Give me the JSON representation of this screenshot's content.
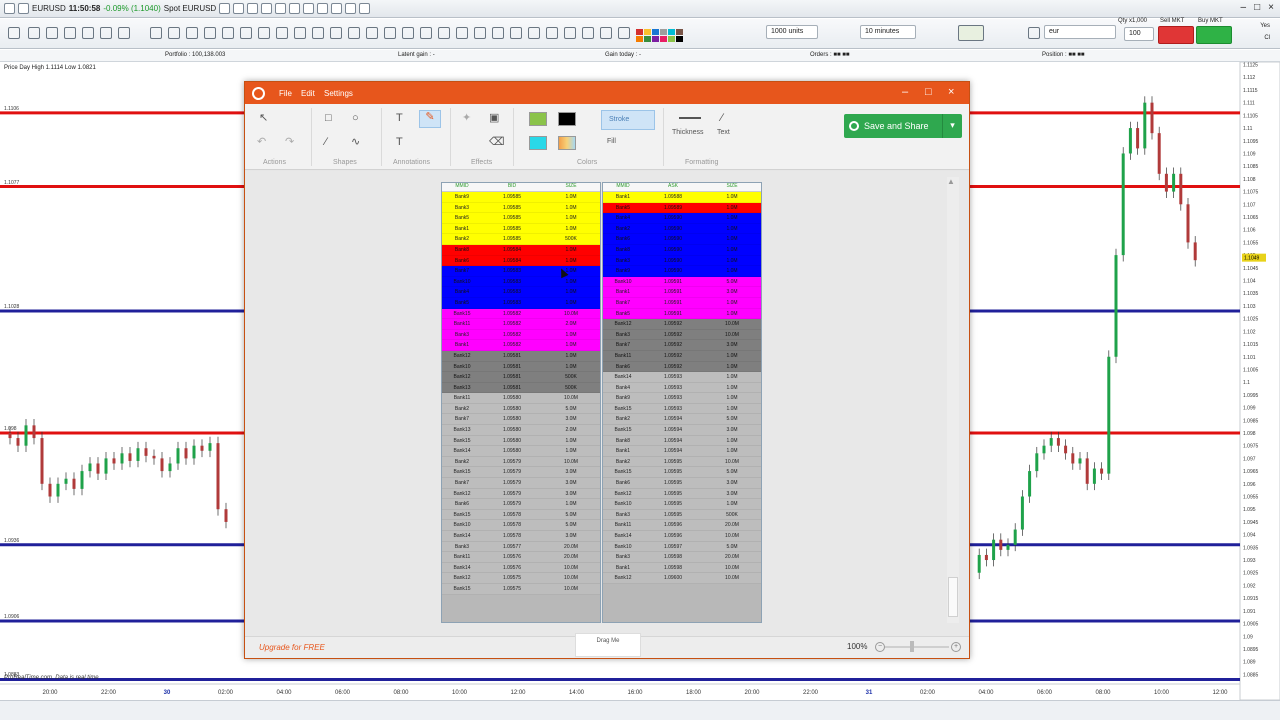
{
  "platform": {
    "top": {
      "instrument": "EURUSD",
      "time": "11:50:58",
      "change": "-0.09% (1.1040)",
      "spot": "Spot EURUSD"
    },
    "units": "1000 units",
    "timeframe": "10 minutes",
    "instrument_field": "eur",
    "order_labels": {
      "qty": "Qty x1,000",
      "sell": "Sell MKT",
      "buy": "Buy MKT"
    },
    "qty_value": "100",
    "side_checks": [
      "Yes",
      "Cl"
    ],
    "infobar": {
      "portfolio": "Portfolio : 100,138.003",
      "latent": "Latent gain : -",
      "gain_today": "Gain today : -",
      "orders": "Orders : ■■ ■■",
      "position": "Position : ■■ ■■"
    },
    "chart_header": "Price  Day High 1.1114 Low 1.0821",
    "watermark": "ProRealTime.com. Data is real time",
    "level_labels": [
      "1.1106",
      "1.1077",
      "1.1028",
      "1.098",
      "1.0936",
      "1.0906",
      "1.0883"
    ]
  },
  "tool": {
    "menu": [
      "File",
      "Edit",
      "Settings"
    ],
    "groups": [
      "Actions",
      "Shapes",
      "Annotations",
      "Effects",
      "Colors",
      "Formatting"
    ],
    "stroke_label": "Stroke",
    "fill_label": "Fill",
    "thickness_label": "Thickness",
    "text_label": "Text",
    "save_label": "Save and Share",
    "upgrade_label": "Upgrade for FREE",
    "drag_label": "Drag Me",
    "zoom_label": "100%",
    "colors": {
      "green": "#8bc34a",
      "black": "#000000",
      "cyan": "#29d8e8",
      "accent": "#e7561c"
    }
  },
  "dom": {
    "bid_header": [
      "MMID",
      "BID",
      "SIZE"
    ],
    "ask_header": [
      "MMID",
      "ASK",
      "SIZE"
    ],
    "bids": [
      [
        "Bank9",
        "1.09585",
        "1.0M"
      ],
      [
        "Bank3",
        "1.09585",
        "1.0M"
      ],
      [
        "Bank5",
        "1.09585",
        "1.0M"
      ],
      [
        "Bank1",
        "1.09585",
        "1.0M"
      ],
      [
        "Bank2",
        "1.09585",
        "500K"
      ],
      [
        "Bank8",
        "1.09584",
        "1.0M"
      ],
      [
        "Bank6",
        "1.09584",
        "1.0M"
      ],
      [
        "Bank7",
        "1.09583",
        "1.0M"
      ],
      [
        "Bank10",
        "1.09583",
        "1.0M"
      ],
      [
        "Bank4",
        "1.09583",
        "1.0M"
      ],
      [
        "Bank5",
        "1.09583",
        "1.0M"
      ],
      [
        "Bank15",
        "1.09582",
        "10.0M"
      ],
      [
        "Bank11",
        "1.09582",
        "2.0M"
      ],
      [
        "Bank3",
        "1.09582",
        "1.0M"
      ],
      [
        "Bank1",
        "1.09582",
        "1.0M"
      ],
      [
        "Bank12",
        "1.09581",
        "1.0M"
      ],
      [
        "Bank10",
        "1.09581",
        "1.0M"
      ],
      [
        "Bank12",
        "1.09581",
        "500K"
      ],
      [
        "Bank13",
        "1.09581",
        "500K"
      ],
      [
        "Bank11",
        "1.09580",
        "10.0M"
      ],
      [
        "Bank2",
        "1.09580",
        "5.0M"
      ],
      [
        "Bank7",
        "1.09580",
        "3.0M"
      ],
      [
        "Bank13",
        "1.09580",
        "2.0M"
      ],
      [
        "Bank15",
        "1.09580",
        "1.0M"
      ],
      [
        "Bank14",
        "1.09580",
        "1.0M"
      ],
      [
        "Bank2",
        "1.09579",
        "10.0M"
      ],
      [
        "Bank15",
        "1.09579",
        "3.0M"
      ],
      [
        "Bank7",
        "1.09579",
        "3.0M"
      ],
      [
        "Bank12",
        "1.09579",
        "3.0M"
      ],
      [
        "Bank6",
        "1.09579",
        "1.0M"
      ],
      [
        "Bank15",
        "1.09578",
        "5.0M"
      ],
      [
        "Bank10",
        "1.09578",
        "5.0M"
      ],
      [
        "Bank14",
        "1.09578",
        "3.0M"
      ],
      [
        "Bank3",
        "1.09577",
        "20.0M"
      ],
      [
        "Bank11",
        "1.09576",
        "20.0M"
      ],
      [
        "Bank14",
        "1.09576",
        "10.0M"
      ],
      [
        "Bank12",
        "1.09575",
        "10.0M"
      ],
      [
        "Bank15",
        "1.09575",
        "10.0M"
      ]
    ],
    "asks": [
      [
        "Bank1",
        "1.09588",
        "1.0M"
      ],
      [
        "Bank5",
        "1.09589",
        "1.0M"
      ],
      [
        "Bank4",
        "1.09590",
        "1.0M"
      ],
      [
        "Bank2",
        "1.09590",
        "1.0M"
      ],
      [
        "Bank6",
        "1.09590",
        "1.0M"
      ],
      [
        "Bank8",
        "1.09590",
        "1.0M"
      ],
      [
        "Bank3",
        "1.09590",
        "1.0M"
      ],
      [
        "Bank9",
        "1.09590",
        "1.0M"
      ],
      [
        "Bank10",
        "1.09591",
        "5.0M"
      ],
      [
        "Bank1",
        "1.09591",
        "3.0M"
      ],
      [
        "Bank7",
        "1.09591",
        "1.0M"
      ],
      [
        "Bank5",
        "1.09591",
        "1.0M"
      ],
      [
        "Bank12",
        "1.09592",
        "10.0M"
      ],
      [
        "Bank3",
        "1.09592",
        "10.0M"
      ],
      [
        "Bank7",
        "1.09592",
        "3.0M"
      ],
      [
        "Bank11",
        "1.09592",
        "1.0M"
      ],
      [
        "Bank6",
        "1.09592",
        "1.0M"
      ],
      [
        "Bank14",
        "1.09593",
        "1.0M"
      ],
      [
        "Bank4",
        "1.09593",
        "1.0M"
      ],
      [
        "Bank9",
        "1.09593",
        "1.0M"
      ],
      [
        "Bank15",
        "1.09593",
        "1.0M"
      ],
      [
        "Bank2",
        "1.09594",
        "5.0M"
      ],
      [
        "Bank15",
        "1.09594",
        "3.0M"
      ],
      [
        "Bank8",
        "1.09594",
        "1.0M"
      ],
      [
        "Bank1",
        "1.09594",
        "1.0M"
      ],
      [
        "Bank2",
        "1.09595",
        "10.0M"
      ],
      [
        "Bank15",
        "1.09595",
        "5.0M"
      ],
      [
        "Bank6",
        "1.09595",
        "3.0M"
      ],
      [
        "Bank12",
        "1.09595",
        "3.0M"
      ],
      [
        "Bank10",
        "1.09595",
        "1.0M"
      ],
      [
        "Bank3",
        "1.09595",
        "500K"
      ],
      [
        "Bank11",
        "1.09596",
        "20.0M"
      ],
      [
        "Bank14",
        "1.09596",
        "10.0M"
      ],
      [
        "Bank10",
        "1.09597",
        "5.0M"
      ],
      [
        "Bank3",
        "1.09598",
        "20.0M"
      ],
      [
        "Bank1",
        "1.09598",
        "10.0M"
      ],
      [
        "Bank12",
        "1.09600",
        "10.0M"
      ]
    ],
    "bid_groups": [
      {
        "count": 5,
        "color": "#ffff00"
      },
      {
        "count": 2,
        "color": "#ff0000"
      },
      {
        "count": 4,
        "color": "#0000ff"
      },
      {
        "count": 4,
        "color": "#ff00ff"
      },
      {
        "count": 4,
        "color": "#7f7f7f"
      }
    ],
    "ask_groups": [
      {
        "count": 1,
        "color": "#ffff00"
      },
      {
        "count": 1,
        "color": "#ff0000"
      },
      {
        "count": 6,
        "color": "#0000ff"
      },
      {
        "count": 4,
        "color": "#ff00ff"
      },
      {
        "count": 5,
        "color": "#7f7f7f"
      }
    ],
    "rest_color": "#bdbdbd"
  },
  "chart_data": {
    "type": "line",
    "x_ticks": [
      "20:00",
      "22:00",
      "30",
      "02:00",
      "04:00",
      "06:00",
      "08:00",
      "10:00",
      "12:00",
      "14:00",
      "16:00",
      "18:00",
      "20:00",
      "22:00",
      "31",
      "02:00",
      "04:00",
      "06:00",
      "08:00",
      "10:00",
      "12:00"
    ],
    "y_ticks": [
      "1.1125",
      "1.112",
      "1.1115",
      "1.111",
      "1.1105",
      "1.11",
      "1.1095",
      "1.109",
      "1.1085",
      "1.108",
      "1.1075",
      "1.107",
      "1.1065",
      "1.106",
      "1.1055",
      "1.105",
      "1.1045",
      "1.104",
      "1.1035",
      "1.103",
      "1.1025",
      "1.102",
      "1.1015",
      "1.101",
      "1.1005",
      "1.1",
      "1.0995",
      "1.099",
      "1.0985",
      "1.098",
      "1.0975",
      "1.097",
      "1.0965",
      "1.096",
      "1.0955",
      "1.095",
      "1.0945",
      "1.094",
      "1.0935",
      "1.093",
      "1.0925",
      "1.092",
      "1.0915",
      "1.091",
      "1.0905",
      "1.09",
      "1.0895",
      "1.089",
      "1.0885"
    ],
    "ylim": [
      1.0882,
      1.1126
    ],
    "levels": [
      {
        "value": 1.1106,
        "color": "#e01010"
      },
      {
        "value": 1.1077,
        "color": "#e01010"
      },
      {
        "value": 1.1028,
        "color": "#20209a"
      },
      {
        "value": 1.098,
        "color": "#e01010"
      },
      {
        "value": 1.0936,
        "color": "#20209a"
      },
      {
        "value": 1.0906,
        "color": "#20209a"
      },
      {
        "value": 1.0883,
        "color": "#20209a"
      }
    ],
    "current_price": "1.1049",
    "left_price_path": [
      1.098,
      1.0978,
      1.0975,
      1.0983,
      1.0978,
      1.096,
      1.0955,
      1.096,
      1.0962,
      1.0958,
      1.0965,
      1.0968,
      1.0964,
      1.097,
      1.0968,
      1.0972,
      1.0969,
      1.0974,
      1.0971,
      1.097,
      1.0965,
      1.0968,
      1.0974,
      1.097,
      1.0975,
      1.0973,
      1.0976,
      1.095,
      1.0945
    ],
    "right_price_path": [
      1.0925,
      1.0932,
      1.093,
      1.0938,
      1.0934,
      1.0936,
      1.0942,
      1.0955,
      1.0965,
      1.0972,
      1.0975,
      1.0978,
      1.0975,
      1.0972,
      1.0968,
      1.097,
      1.096,
      1.0966,
      1.0964,
      1.101,
      1.105,
      1.109,
      1.11,
      1.1092,
      1.111,
      1.1098,
      1.1082,
      1.1075,
      1.1082,
      1.107,
      1.1055,
      1.1048
    ]
  }
}
